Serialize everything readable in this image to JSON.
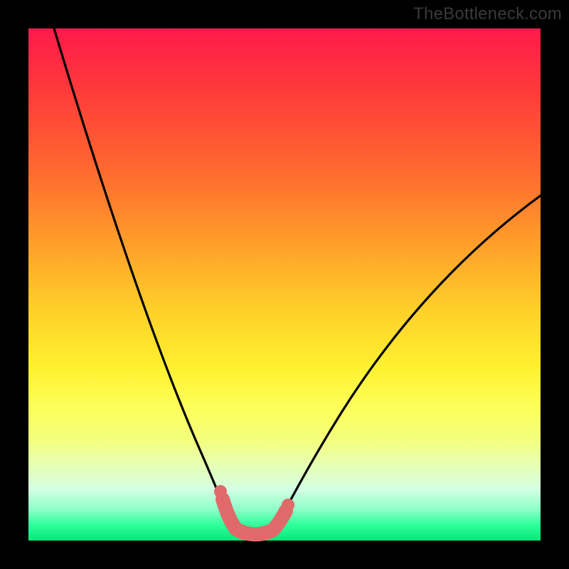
{
  "watermark": "TheBottleneck.com",
  "chart_data": {
    "type": "line",
    "title": "",
    "xlabel": "",
    "ylabel": "",
    "xlim": [
      0,
      100
    ],
    "ylim": [
      0,
      100
    ],
    "grid": false,
    "legend": false,
    "background_gradient": {
      "top_color": "#ff1a4b",
      "bottom_color": "#06e878",
      "description": "heat-map style gradient from red (top, high bottleneck) to green (bottom, low bottleneck)"
    },
    "series": [
      {
        "name": "left-branch",
        "description": "steep descending curve from upper-left into the well",
        "x": [
          5,
          10,
          15,
          20,
          25,
          30,
          33,
          36,
          38,
          39,
          40
        ],
        "y": [
          100,
          84,
          68,
          52,
          36,
          20,
          12,
          6,
          3,
          2,
          1
        ]
      },
      {
        "name": "right-branch",
        "description": "ascending curve from the well toward upper-right",
        "x": [
          48,
          50,
          53,
          57,
          62,
          68,
          75,
          83,
          91,
          100
        ],
        "y": [
          1,
          3,
          7,
          13,
          21,
          30,
          40,
          50,
          59,
          68
        ]
      },
      {
        "name": "well-floor",
        "description": "flat minimum segment between branches",
        "x": [
          40,
          44,
          48
        ],
        "y": [
          1,
          0,
          1
        ]
      }
    ],
    "markers": [
      {
        "name": "marker-left-upper",
        "x": 38,
        "y": 6.5,
        "approx": true
      },
      {
        "name": "marker-left-lower",
        "x": 39,
        "y": 3.5,
        "approx": true
      },
      {
        "name": "marker-right",
        "x": 50,
        "y": 4,
        "approx": true
      }
    ],
    "well_segment": {
      "description": "thick red caterpillar-like marker tracing the bottom of the well",
      "color": "#e06a6a",
      "points_xy": [
        [
          37.5,
          8.5
        ],
        [
          38.3,
          5.5
        ],
        [
          39.2,
          3.0
        ],
        [
          40.5,
          1.2
        ],
        [
          42.5,
          0.4
        ],
        [
          44.5,
          0.2
        ],
        [
          46.5,
          0.6
        ],
        [
          48.0,
          1.5
        ],
        [
          49.3,
          3.2
        ],
        [
          50.3,
          5.0
        ]
      ]
    }
  }
}
